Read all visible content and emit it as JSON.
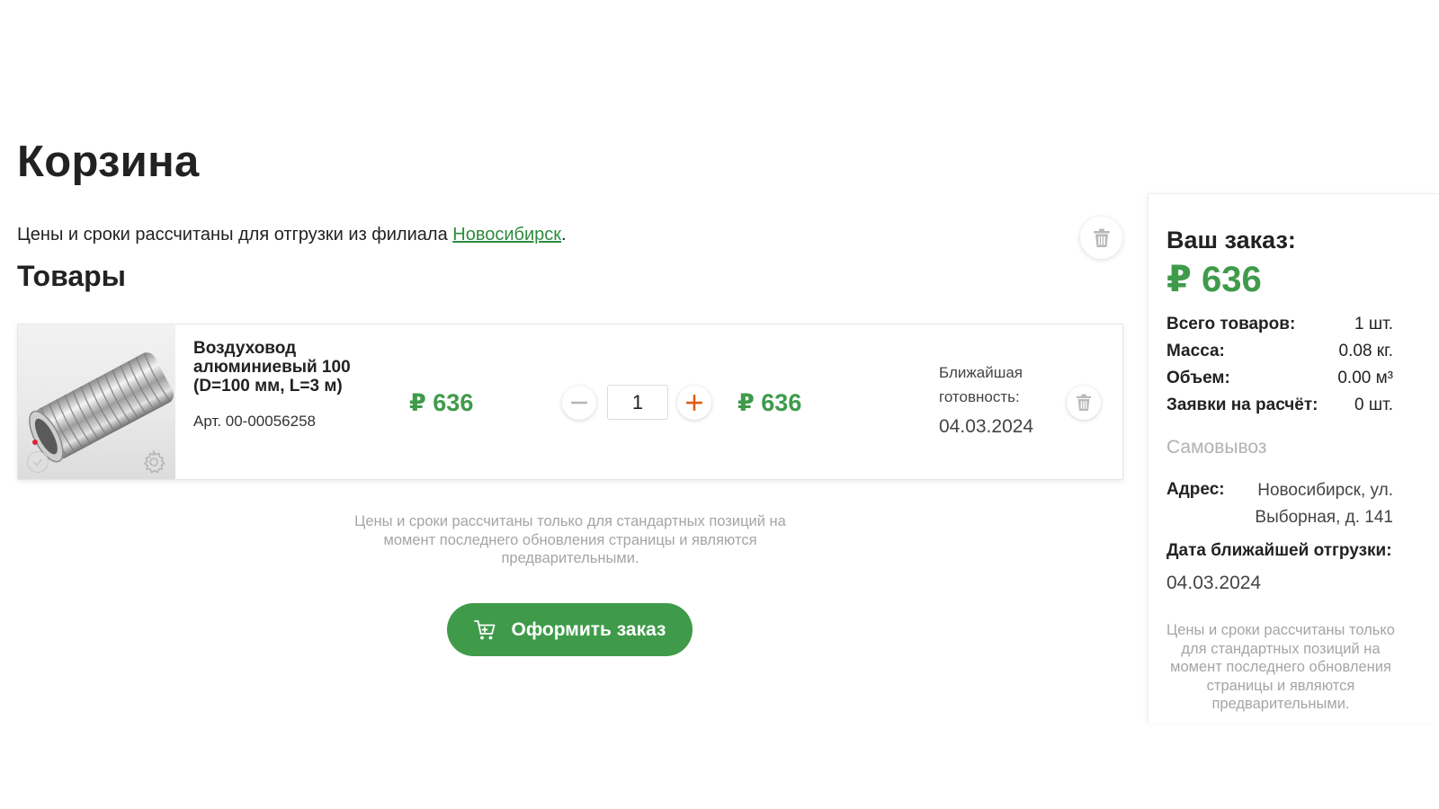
{
  "page": {
    "title": "Корзина",
    "branch_note_prefix": "Цены и сроки рассчитаны для отгрузки из филиала ",
    "branch_link": "Новосибирск",
    "branch_note_suffix": ".",
    "section_title": "Товары"
  },
  "cart_item": {
    "name": "Воздуховод алюминиевый 100 (D=100 мм, L=3 м)",
    "sku": "Арт. 00-00056258",
    "unit_price": "₽ 636",
    "quantity": "1",
    "total_price": "₽ 636",
    "ready_label": "Ближайшая готовность:",
    "ready_date": "04.03.2024"
  },
  "disclaimer": "Цены и сроки рассчитаны только для стандартных позиций на момент последнего обновления страницы и являются предварительными.",
  "checkout": {
    "label": "Оформить заказ"
  },
  "summary": {
    "title": "Ваш заказ:",
    "total": "₽ 636",
    "rows": [
      {
        "key": "Всего товаров:",
        "value": "1 шт."
      },
      {
        "key": "Масса:",
        "value": "0.08 кг."
      },
      {
        "key": "Объем:",
        "value": "0.00 м³"
      },
      {
        "key": "Заявки на расчёт:",
        "value": "0 шт."
      }
    ],
    "pickup_label": "Самовывоз",
    "address_key": "Адрес:",
    "address_value": "Новосибирск, ул. Выборная, д. 141",
    "shipment_key": "Дата ближайшей отгрузки:",
    "shipment_date": "04.03.2024",
    "disclaimer": "Цены и сроки рассчитаны только для стандартных позиций на момент последнего обновления страницы и являются предварительными."
  },
  "icons": {
    "trash": "trash-icon",
    "minus": "minus-icon",
    "plus": "plus-icon",
    "cart": "cart-icon",
    "gear": "gear-icon",
    "check": "check-icon"
  },
  "colors": {
    "accent_green": "#3f9b4a",
    "plus_orange": "#e05a12",
    "muted_text": "#a5a5a5"
  }
}
